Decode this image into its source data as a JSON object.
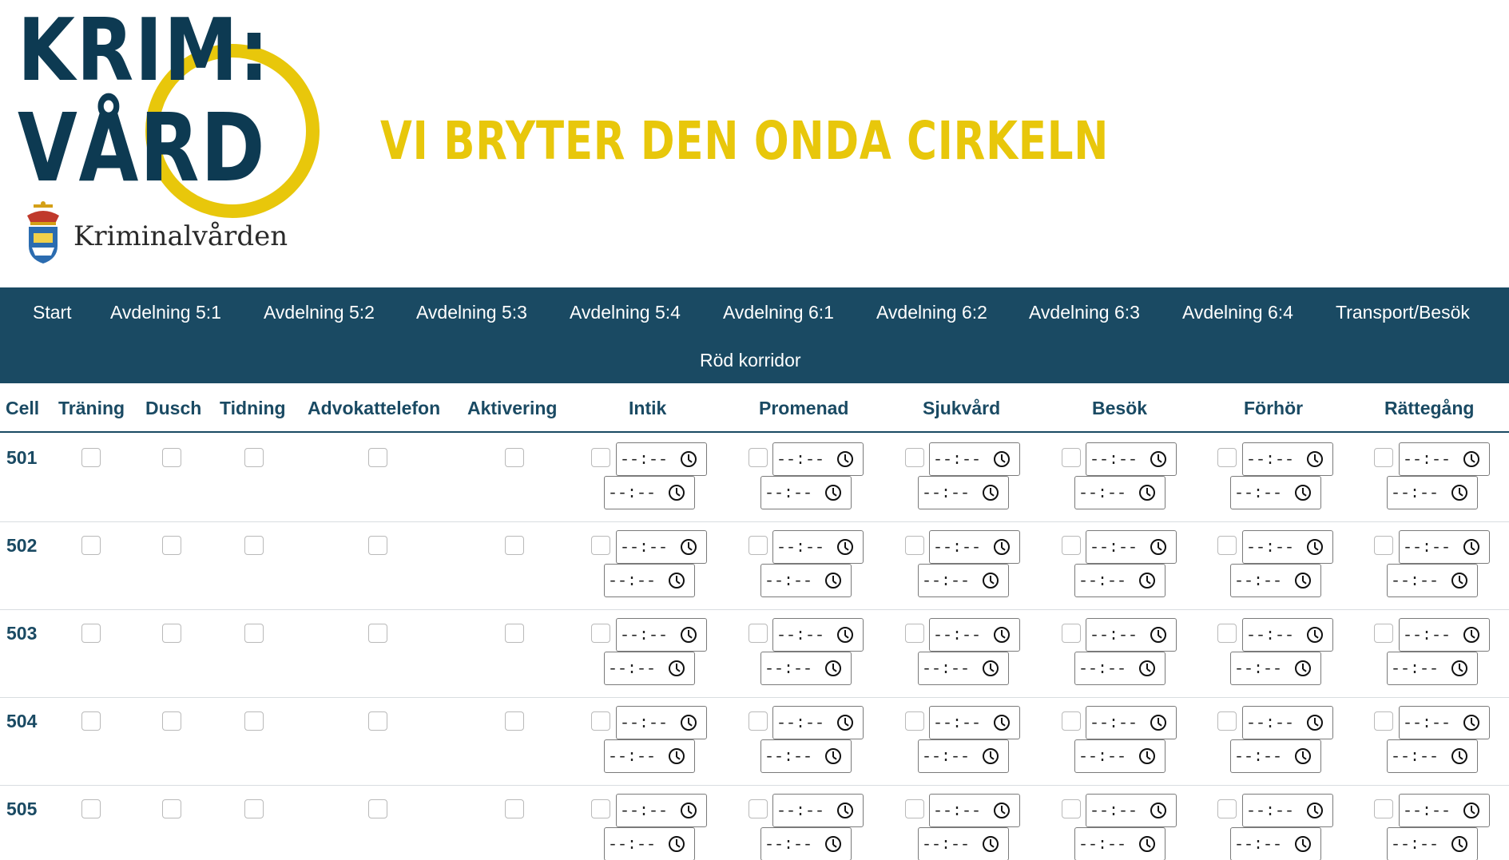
{
  "brand": {
    "logo_line1": "KRIM:",
    "logo_line2": "VÅRD",
    "org_name": "Kriminalvården",
    "slogan": "VI BRYTER DEN ONDA CIRKELN",
    "colors": {
      "navy": "#1a4a63",
      "yellow": "#e8c70b"
    }
  },
  "nav": {
    "items": [
      "Start",
      "Avdelning 5:1",
      "Avdelning 5:2",
      "Avdelning 5:3",
      "Avdelning 5:4",
      "Avdelning 6:1",
      "Avdelning 6:2",
      "Avdelning 6:3",
      "Avdelning 6:4",
      "Transport/Besök",
      "Röd korridor"
    ]
  },
  "table": {
    "columns": [
      "Cell",
      "Träning",
      "Dusch",
      "Tidning",
      "Advokattelefon",
      "Aktivering",
      "Intik",
      "Promenad",
      "Sjukvård",
      "Besök",
      "Förhör",
      "Rättegång"
    ],
    "time_placeholder": "--:--",
    "rows": [
      "501",
      "502",
      "503",
      "504",
      "505"
    ]
  }
}
